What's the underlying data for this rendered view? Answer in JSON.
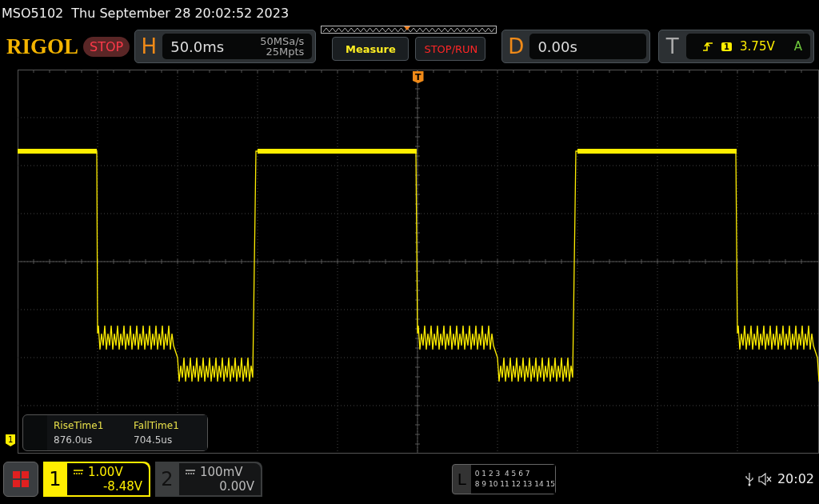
{
  "status_line": {
    "model": "MSO5102",
    "datetime": "Thu September 28 20:02:52 2023"
  },
  "toolbar": {
    "logo": "RIGOL",
    "run_state": "STOP",
    "horizontal": {
      "label": "H",
      "timebase": "50.0ms",
      "sample_rate": "50MSa/s",
      "memory_depth": "25Mpts"
    },
    "buttons": [
      {
        "label": "Measure",
        "kind": "measure"
      },
      {
        "label": "STOP/RUN",
        "kind": "stoprun"
      }
    ],
    "delay": {
      "label": "D",
      "value": "0.00s"
    },
    "trigger": {
      "label": "T",
      "source": "1",
      "level": "3.75V",
      "mode": "A"
    }
  },
  "screen": {
    "trigger_marker": "T",
    "channel_marker": "1"
  },
  "measurements": [
    {
      "name": "RiseTime1",
      "value": "876.0us"
    },
    {
      "name": "FallTime1",
      "value": "704.5us"
    }
  ],
  "channels": [
    {
      "number": "1",
      "scale": "1.00V",
      "offset": "-8.48V",
      "on": true
    },
    {
      "number": "2",
      "scale": "100mV",
      "offset": "0.00V",
      "on": false
    }
  ],
  "logic": {
    "label": "L",
    "row_1": "0 1 2 3  4 5 6 7",
    "row_2": "8 9 10 11 12 13 14 15"
  },
  "status": {
    "clock": "20:02"
  }
}
